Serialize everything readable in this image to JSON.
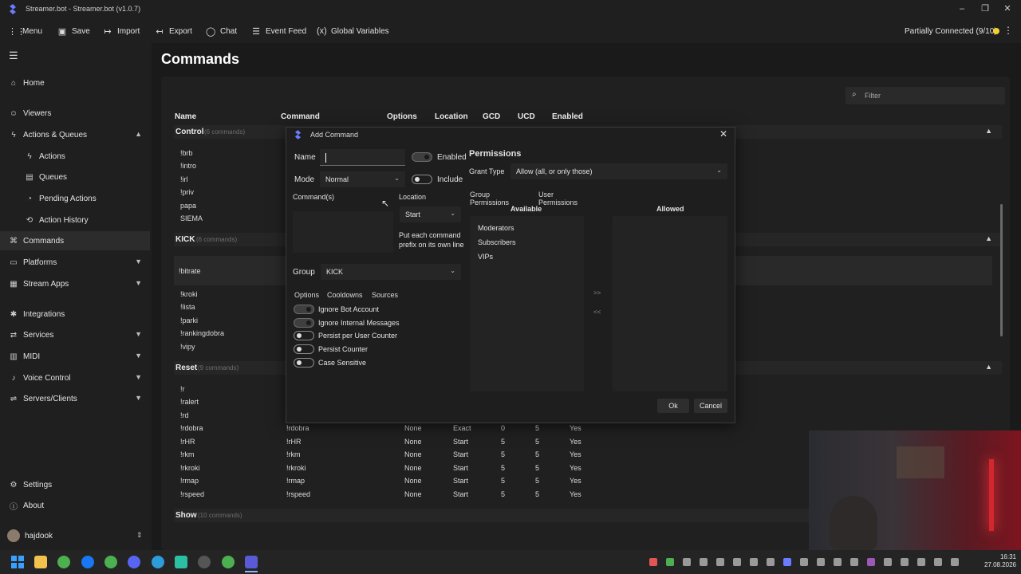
{
  "window": {
    "title": "Streamer.bot - Streamer.bot (v1.0.7)"
  },
  "menubar": {
    "items": [
      {
        "label": "Menu",
        "icon": "grid-icon"
      },
      {
        "label": "Save",
        "icon": "save-icon"
      },
      {
        "label": "Import",
        "icon": "import-icon"
      },
      {
        "label": "Export",
        "icon": "export-icon"
      },
      {
        "label": "Chat",
        "icon": "chat-icon"
      },
      {
        "label": "Event Feed",
        "icon": "event-feed-icon"
      },
      {
        "label": "Global Variables",
        "icon": "variables-icon"
      }
    ],
    "status": "Partially Connected (9/10)",
    "status_color": "#f3d12e"
  },
  "sidebar": {
    "items": [
      {
        "label": "Home"
      },
      {
        "label": "Viewers"
      },
      {
        "label": "Actions & Queues"
      },
      {
        "label": "Actions"
      },
      {
        "label": "Queues"
      },
      {
        "label": "Pending Actions"
      },
      {
        "label": "Action History"
      },
      {
        "label": "Commands"
      },
      {
        "label": "Platforms"
      },
      {
        "label": "Stream Apps"
      },
      {
        "label": "Integrations"
      },
      {
        "label": "Services"
      },
      {
        "label": "MIDI"
      },
      {
        "label": "Voice Control"
      },
      {
        "label": "Servers/Clients"
      },
      {
        "label": "Settings"
      },
      {
        "label": "About"
      }
    ],
    "user": "hajdook"
  },
  "page": {
    "title": "Commands",
    "filter_placeholder": "Filter"
  },
  "table": {
    "columns": [
      "Name",
      "Command",
      "Options",
      "Location",
      "GCD",
      "UCD",
      "Enabled"
    ],
    "groups": [
      {
        "name": "Control",
        "count": "(6 commands)",
        "rows": [
          "!brb",
          "!intro",
          "!irl",
          "!priv",
          "papa",
          "SIEMA"
        ]
      },
      {
        "name": "KICK",
        "count": "(6 commands)",
        "rows": [
          "!bitrate",
          "!kroki",
          "!lista",
          "!parki",
          "!rankingdobra",
          "!vipy"
        ]
      },
      {
        "name": "Reset",
        "count": "(9 commands)",
        "rows": [
          {
            "name": "!r"
          },
          {
            "name": "!ralert"
          },
          {
            "name": "!rd"
          },
          {
            "name": "!rdobra",
            "command": "!rdobra",
            "options": "None",
            "location": "Exact",
            "gcd": "0",
            "ucd": "5",
            "enabled": "Yes"
          },
          {
            "name": "!rHR",
            "command": "!rHR",
            "options": "None",
            "location": "Start",
            "gcd": "5",
            "ucd": "5",
            "enabled": "Yes"
          },
          {
            "name": "!rkm",
            "command": "!rkm",
            "options": "None",
            "location": "Start",
            "gcd": "5",
            "ucd": "5",
            "enabled": "Yes"
          },
          {
            "name": "!rkroki",
            "command": "!rkroki",
            "options": "None",
            "location": "Start",
            "gcd": "5",
            "ucd": "5",
            "enabled": "Yes"
          },
          {
            "name": "!rmap",
            "command": "!rmap",
            "options": "None",
            "location": "Start",
            "gcd": "5",
            "ucd": "5",
            "enabled": "Yes"
          },
          {
            "name": "!rspeed",
            "command": "!rspeed",
            "options": "None",
            "location": "Start",
            "gcd": "5",
            "ucd": "5",
            "enabled": "Yes"
          }
        ]
      },
      {
        "name": "Show",
        "count": "(10 commands)",
        "rows": []
      }
    ]
  },
  "dialog": {
    "title": "Add Command",
    "name_label": "Name",
    "name_value": "",
    "enabled_label": "Enabled",
    "mode_label": "Mode",
    "mode_value": "Normal",
    "include_label": "Include",
    "commands_label": "Command(s)",
    "location_label": "Location",
    "location_value": "Start",
    "location_hint": "Put each command prefix on its own line",
    "group_label": "Group",
    "group_value": "KICK",
    "tabs": [
      "Options",
      "Cooldowns",
      "Sources"
    ],
    "options": [
      {
        "label": "Ignore Bot Account",
        "on": true
      },
      {
        "label": "Ignore Internal Messages",
        "on": true
      },
      {
        "label": "Persist per User Counter",
        "on": false
      },
      {
        "label": "Persist Counter",
        "on": false
      },
      {
        "label": "Case Sensitive",
        "on": false
      }
    ],
    "permissions": {
      "title": "Permissions",
      "grant_type_label": "Grant Type",
      "grant_type_value": "Allow (all, or only those)",
      "tabs": [
        "Group Permissions",
        "User Permissions"
      ],
      "available_label": "Available",
      "allowed_label": "Allowed",
      "available": [
        "Moderators",
        "Subscribers",
        "VIPs"
      ],
      "add_label": ">>",
      "remove_label": "<<"
    },
    "ok_label": "Ok",
    "cancel_label": "Cancel"
  },
  "taskbar": {
    "time": "16:31",
    "date": "27.08.2026"
  }
}
